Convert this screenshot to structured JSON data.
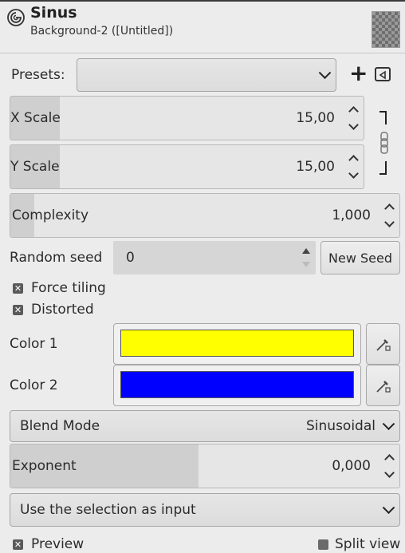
{
  "header": {
    "title": "Sinus",
    "subtitle": "Background-2 ([Untitled])"
  },
  "presets": {
    "label": "Presets:",
    "value": ""
  },
  "x_scale": {
    "label": "X Scale",
    "value": "15,00",
    "fill_fraction": 0.12
  },
  "y_scale": {
    "label": "Y Scale",
    "value": "15,00",
    "fill_fraction": 0.12
  },
  "complexity": {
    "label": "Complexity",
    "value": "1,000",
    "fill_fraction": 0.06
  },
  "random_seed": {
    "label": "Random seed",
    "value": "0",
    "button": "New Seed"
  },
  "force_tiling": {
    "label": "Force tiling",
    "checked": true
  },
  "distorted": {
    "label": "Distorted",
    "checked": true
  },
  "color1": {
    "label": "Color 1",
    "value": "#ffff00"
  },
  "color2": {
    "label": "Color 2",
    "value": "#0000ff"
  },
  "blend_mode": {
    "label": "Blend Mode",
    "value": "Sinusoidal"
  },
  "exponent": {
    "label": "Exponent",
    "value": "0,000",
    "fill_fraction": 0.5
  },
  "selection_input": {
    "value": "Use the selection as input"
  },
  "preview": {
    "label": "Preview",
    "checked": true
  },
  "split_view": {
    "label": "Split view",
    "checked": false
  }
}
